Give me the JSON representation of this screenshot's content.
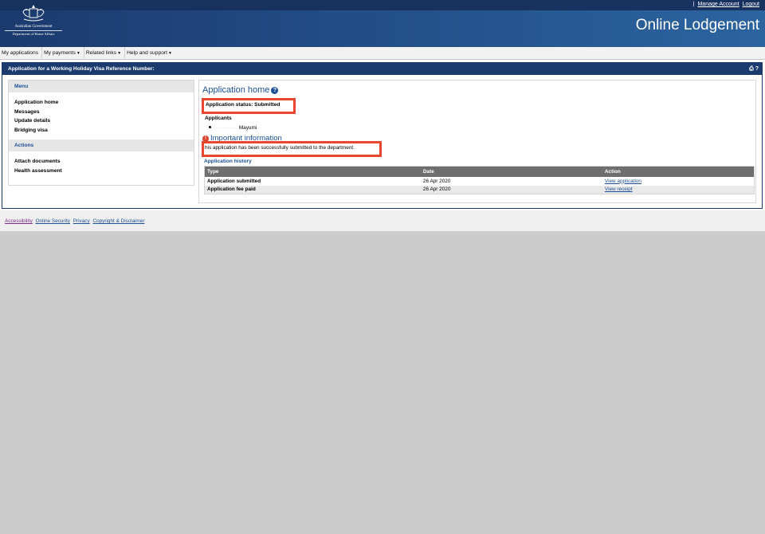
{
  "header": {
    "top_separator": "|",
    "manage_account": "Manage Account",
    "logout": "Logout",
    "brand_title": "Online Lodgement",
    "gov_name": "Australian Government",
    "dept_name": "Department of Home Affairs"
  },
  "nav": {
    "items": [
      {
        "label": "My applications",
        "dropdown": false
      },
      {
        "label": "My payments",
        "dropdown": true
      },
      {
        "label": "Related links",
        "dropdown": true
      },
      {
        "label": "Help and support",
        "dropdown": true
      }
    ]
  },
  "panel": {
    "title": "Application for a Working Holiday Visa Reference Number:",
    "tools": "⎙ ?"
  },
  "sidebar": {
    "menu_heading": "Menu",
    "menu_items": [
      "Application home",
      "Messages",
      "Update details",
      "Bridging visa"
    ],
    "actions_heading": "Actions",
    "action_items": [
      "Attach documents",
      "Health assessment"
    ]
  },
  "main": {
    "title": "Application home",
    "status": "Application status: Submitted",
    "applicants_label": "Applicants",
    "applicant_masked": "········",
    "applicant_name": "Mayumi",
    "important_title": "Important information",
    "info_text": "his application has been successfully submitted to the department.",
    "history_title": "Application history",
    "history_headers": [
      "Type",
      "Date",
      "Action"
    ],
    "history_rows": [
      {
        "type": "Application submitted",
        "date": "26 Apr 2020",
        "action": "View application"
      },
      {
        "type": "Application fee paid",
        "date": "26 Apr 2020",
        "action": "View receipt"
      }
    ]
  },
  "footer": {
    "links": [
      "Accessibility",
      "Online Security",
      "Privacy",
      "Copyright & Disclaimer"
    ]
  },
  "colors": {
    "header_dark": "#1b3a6e",
    "link_blue": "#1b4e93",
    "highlight_red": "#e8472d",
    "table_header": "#6e6e6e"
  }
}
